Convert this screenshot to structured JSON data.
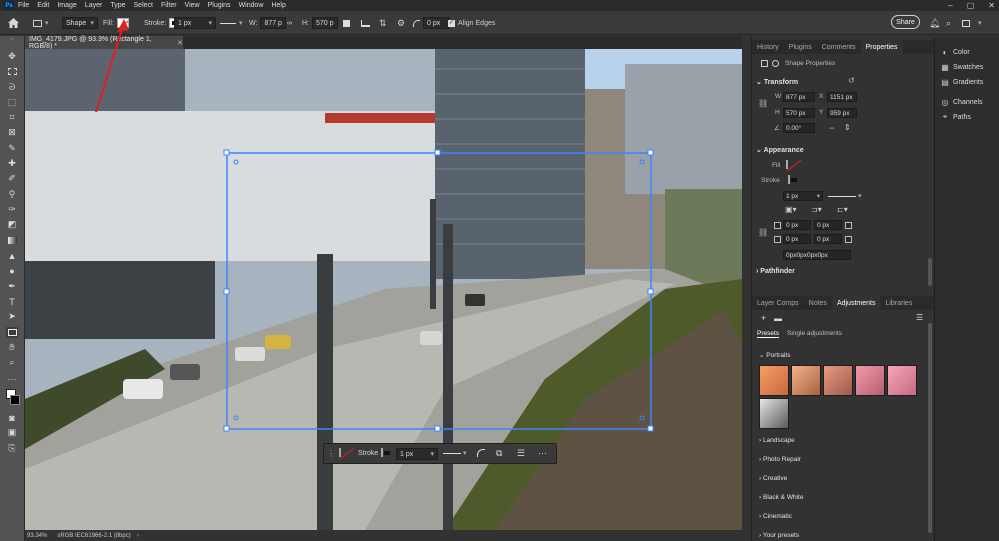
{
  "menu": {
    "items": [
      "File",
      "Edit",
      "Image",
      "Layer",
      "Type",
      "Select",
      "Filter",
      "View",
      "Plugins",
      "Window",
      "Help"
    ]
  },
  "options_bar": {
    "shape_mode": "Shape",
    "fill_label": "Fill:",
    "stroke_label": "Stroke:",
    "stroke_width": "1 px",
    "w_label": "W:",
    "w_value": "877 p",
    "h_label": "H:",
    "h_value": "570 p",
    "radius_value": "0 px",
    "align_edges_label": "Align Edges",
    "share_label": "Share"
  },
  "document": {
    "tab_title": "IMG_4179.JPG @ 93.3% (Rectangle 1, RGB/8) *"
  },
  "status": {
    "zoom": "93.34%",
    "profile": "sRGB IEC61966-2.1 (8bpc)"
  },
  "panels": {
    "top_tabs": [
      "History",
      "Plugins",
      "Comments",
      "Properties"
    ],
    "shape_properties_label": "Shape Properties",
    "transform": {
      "title": "Transform",
      "w_label": "W",
      "w_value": "877 px",
      "x_label": "X",
      "x_value": "1151 px",
      "h_label": "H",
      "h_value": "570 px",
      "y_label": "Y",
      "y_value": "959 px",
      "angle_value": "0.00°"
    },
    "appearance": {
      "title": "Appearance",
      "fill_label": "Fill",
      "stroke_label": "Stroke",
      "stroke_width": "1 px",
      "corner_values": [
        "0 px",
        "0 px",
        "0 px",
        "0 px"
      ],
      "corner_combined": "0px0px0px0px"
    },
    "pathfinder_title": "Pathfinder",
    "bottom_tabs": [
      "Layer Comps",
      "Notes",
      "Adjustments",
      "Libraries"
    ],
    "sub_tabs": [
      "Presets",
      "Single adjustments"
    ],
    "preset_groups": [
      "Portraits",
      "Landscape",
      "Photo Repair",
      "Creative",
      "Black & White",
      "Cinematic",
      "Your presets"
    ]
  },
  "icon_strip": [
    "Color",
    "Swatches",
    "Gradients",
    "Channels",
    "Paths"
  ],
  "context_bar": {
    "stroke_label": "Stroke",
    "stroke_width": "1 px"
  },
  "colors": {
    "selection_blue": "#3a86ff",
    "arrow_red": "#e02020",
    "accent": "#35a3ff"
  }
}
